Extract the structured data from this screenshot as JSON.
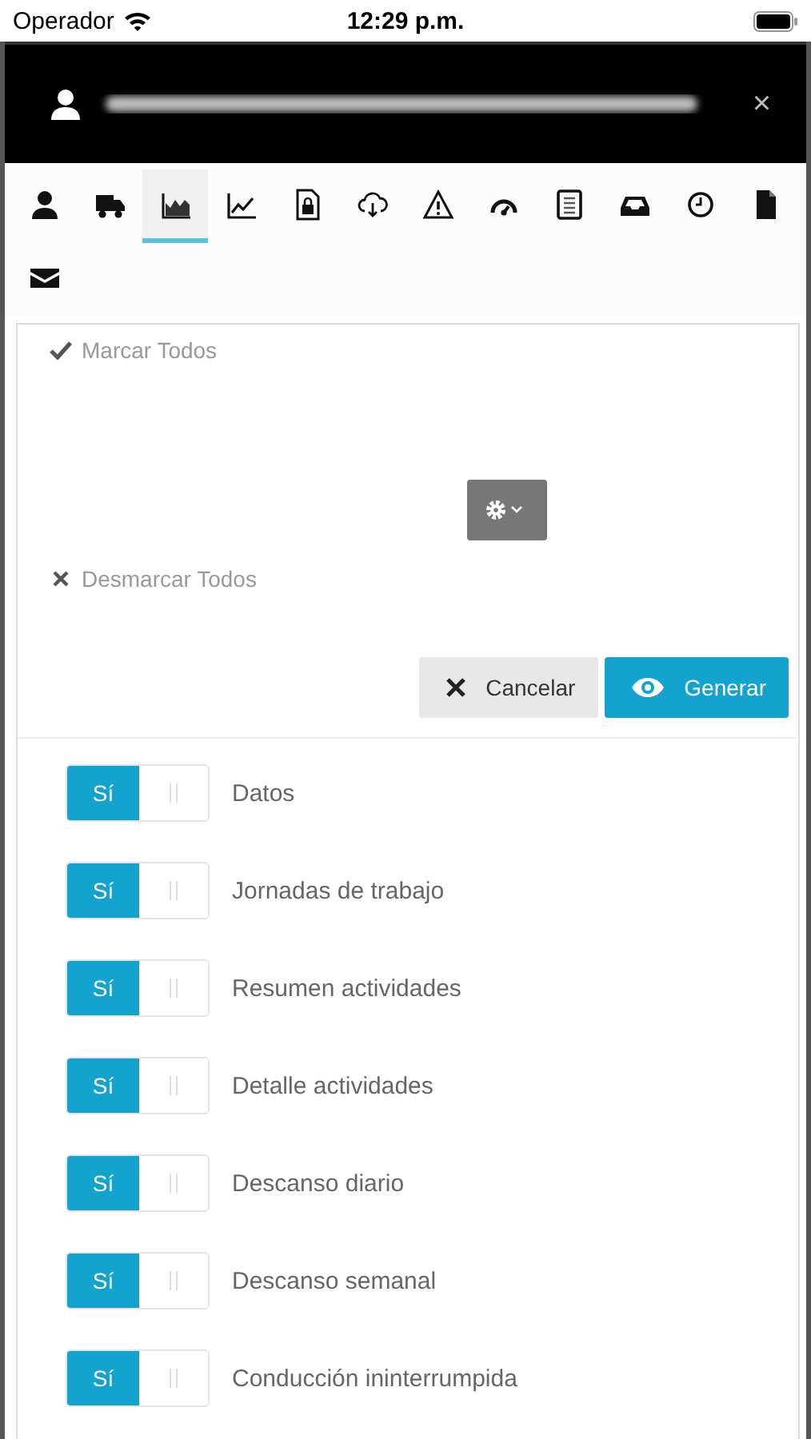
{
  "status_bar": {
    "carrier": "Operador",
    "time": "12:29 p.m."
  },
  "header": {
    "close": "×"
  },
  "tabs": [
    {
      "kind": "person",
      "selected": false
    },
    {
      "kind": "truck",
      "selected": false
    },
    {
      "kind": "area",
      "selected": true
    },
    {
      "kind": "line",
      "selected": false
    },
    {
      "kind": "lock",
      "selected": false
    },
    {
      "kind": "cloud",
      "selected": false
    },
    {
      "kind": "warning",
      "selected": false
    },
    {
      "kind": "gauge",
      "selected": false
    },
    {
      "kind": "document",
      "selected": false
    },
    {
      "kind": "inbox",
      "selected": false
    },
    {
      "kind": "clock",
      "selected": false
    },
    {
      "kind": "file",
      "selected": false
    },
    {
      "kind": "mail",
      "selected": false
    }
  ],
  "actions": {
    "select_all": "Marcar Todos",
    "deselect_all": "Desmarcar Todos",
    "cancel": "Cancelar",
    "generate": "Generar"
  },
  "options": [
    {
      "label": "Datos",
      "toggle": "Sí",
      "on": true
    },
    {
      "label": "Jornadas de trabajo",
      "toggle": "Sí",
      "on": true
    },
    {
      "label": "Resumen actividades",
      "toggle": "Sí",
      "on": true
    },
    {
      "label": "Detalle actividades",
      "toggle": "Sí",
      "on": true
    },
    {
      "label": "Descanso diario",
      "toggle": "Sí",
      "on": true
    },
    {
      "label": "Descanso semanal",
      "toggle": "Sí",
      "on": true
    },
    {
      "label": "Conducción ininterrumpida",
      "toggle": "Sí",
      "on": true
    }
  ]
}
